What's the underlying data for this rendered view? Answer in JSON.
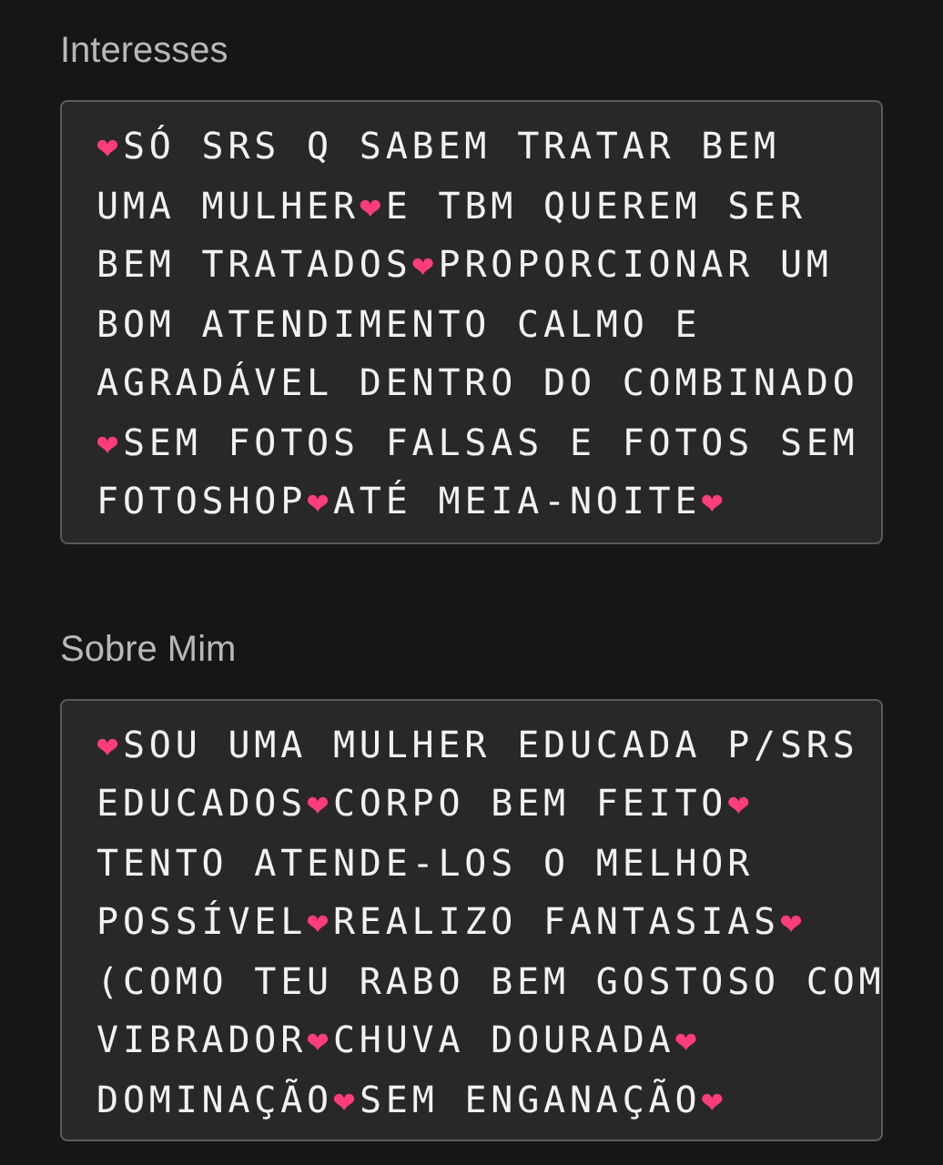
{
  "sections": [
    {
      "label": "Interesses",
      "lines": [
        "❤SÓ SRS Q SABEM TRATAR BEM",
        "UMA MULHER❤E TBM QUEREM SER",
        "BEM TRATADOS❤PROPORCIONAR UM",
        "BOM ATENDIMENTO CALMO E",
        "AGRADÁVEL DENTRO DO COMBINADO",
        "❤SEM FOTOS FALSAS E FOTOS SEM",
        "FOTOSHOP❤ATÉ MEIA-NOITE❤"
      ]
    },
    {
      "label": "Sobre Mim",
      "lines": [
        "❤SOU UMA MULHER EDUCADA P/SRS",
        "EDUCADOS❤CORPO BEM FEITO❤",
        "TENTO ATENDE-LOS O MELHOR",
        "POSSÍVEL❤REALIZO FANTASIAS❤",
        "(COMO TEU RABO BEM GOSTOSO COM",
        "VIBRADOR❤CHUVA DOURADA❤",
        "DOMINAÇÃO❤SEM ENGANAÇÃO❤"
      ]
    }
  ]
}
